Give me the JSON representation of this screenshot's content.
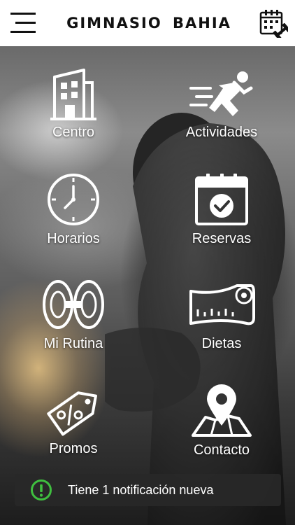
{
  "header": {
    "title": "GIMNASIO  BAHIA",
    "menu_icon": "hamburger-menu-icon",
    "calendar_icon": "calendar-dumbbell-icon"
  },
  "menu": {
    "items": [
      {
        "label": "Centro",
        "icon": "building-icon"
      },
      {
        "label": "Actividades",
        "icon": "running-person-icon"
      },
      {
        "label": "Horarios",
        "icon": "clock-icon"
      },
      {
        "label": "Reservas",
        "icon": "calendar-check-icon"
      },
      {
        "label": "Mi Rutina",
        "icon": "weight-plates-icon"
      },
      {
        "label": "Dietas",
        "icon": "measuring-tape-icon"
      },
      {
        "label": "Promos",
        "icon": "percent-tag-icon"
      },
      {
        "label": "Contacto",
        "icon": "map-pin-icon"
      }
    ]
  },
  "notification": {
    "text": "Tiene 1 notificación nueva",
    "icon": "exclamation-circle-icon",
    "icon_color": "#3fbf3f"
  },
  "colors": {
    "header_bg": "#ffffff",
    "icon_color": "#ffffff",
    "notification_bg": "#282828"
  }
}
